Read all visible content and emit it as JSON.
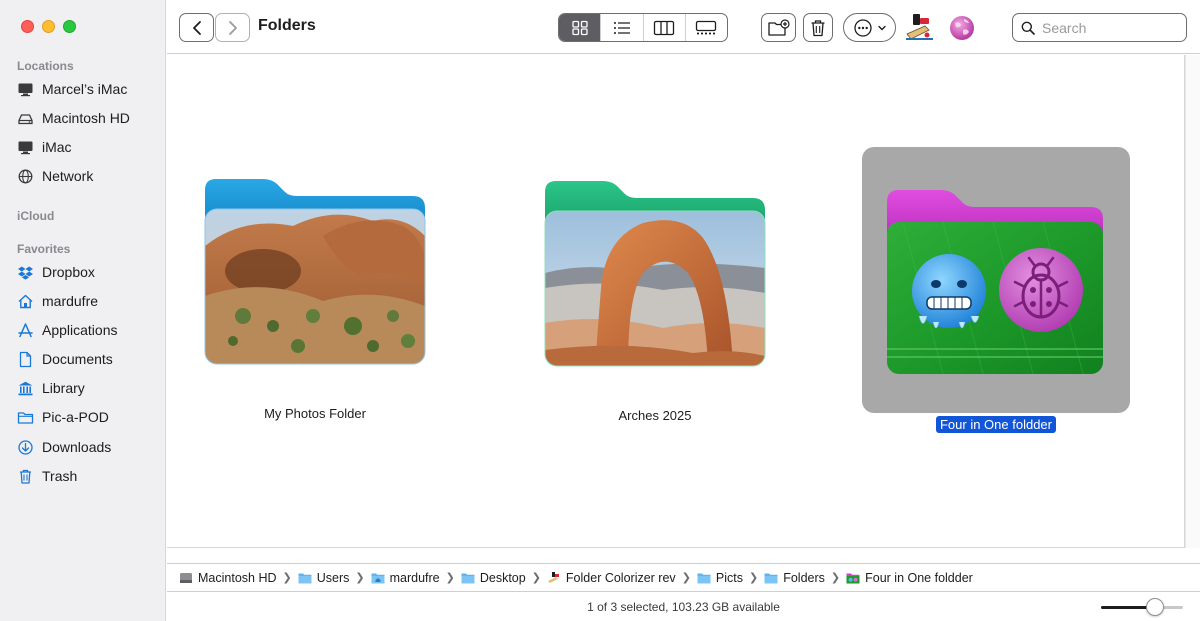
{
  "window": {
    "title": "Folders"
  },
  "sidebar": {
    "sections": [
      {
        "heading": "Locations",
        "items": [
          {
            "label": "Marcel’s iMac",
            "icon": "display-icon"
          },
          {
            "label": "Macintosh HD",
            "icon": "drive-icon"
          },
          {
            "label": "iMac",
            "icon": "display-icon"
          },
          {
            "label": "Network",
            "icon": "globe-icon"
          }
        ]
      },
      {
        "heading": "iCloud",
        "items": []
      },
      {
        "heading": "Favorites",
        "items": [
          {
            "label": "Dropbox",
            "icon": "dropbox-icon"
          },
          {
            "label": "mardufre",
            "icon": "home-icon"
          },
          {
            "label": "Applications",
            "icon": "applications-icon"
          },
          {
            "label": "Documents",
            "icon": "document-icon"
          },
          {
            "label": "Library",
            "icon": "library-icon"
          },
          {
            "label": "Pic-a-POD",
            "icon": "folder-icon"
          },
          {
            "label": "Downloads",
            "icon": "download-icon"
          },
          {
            "label": "Trash",
            "icon": "trash-icon"
          }
        ]
      }
    ]
  },
  "toolbar": {
    "view_modes": [
      "icon-view",
      "list-view",
      "column-view",
      "gallery-view"
    ],
    "active_view": "icon-view",
    "search_placeholder": "Search"
  },
  "folders": [
    {
      "name": "My Photos Folder",
      "color": "#1a9ad6",
      "selected": false
    },
    {
      "name": "Arches 2025",
      "color": "#1fb373",
      "selected": false
    },
    {
      "name": "Four in One foldder",
      "color": "#d93bd6",
      "selected": true
    }
  ],
  "pathbar": [
    "Macintosh HD",
    "Users",
    "mardufre",
    "Desktop",
    "Folder Colorizer rev",
    "Picts",
    "Folders",
    "Four in One foldder"
  ],
  "status": {
    "text": "1 of 3 selected, 103.23 GB available"
  },
  "icon_size_slider": {
    "value": 0.7
  },
  "colors": {
    "selection": "#1156d6",
    "accent_blue": "#1a78d6"
  }
}
